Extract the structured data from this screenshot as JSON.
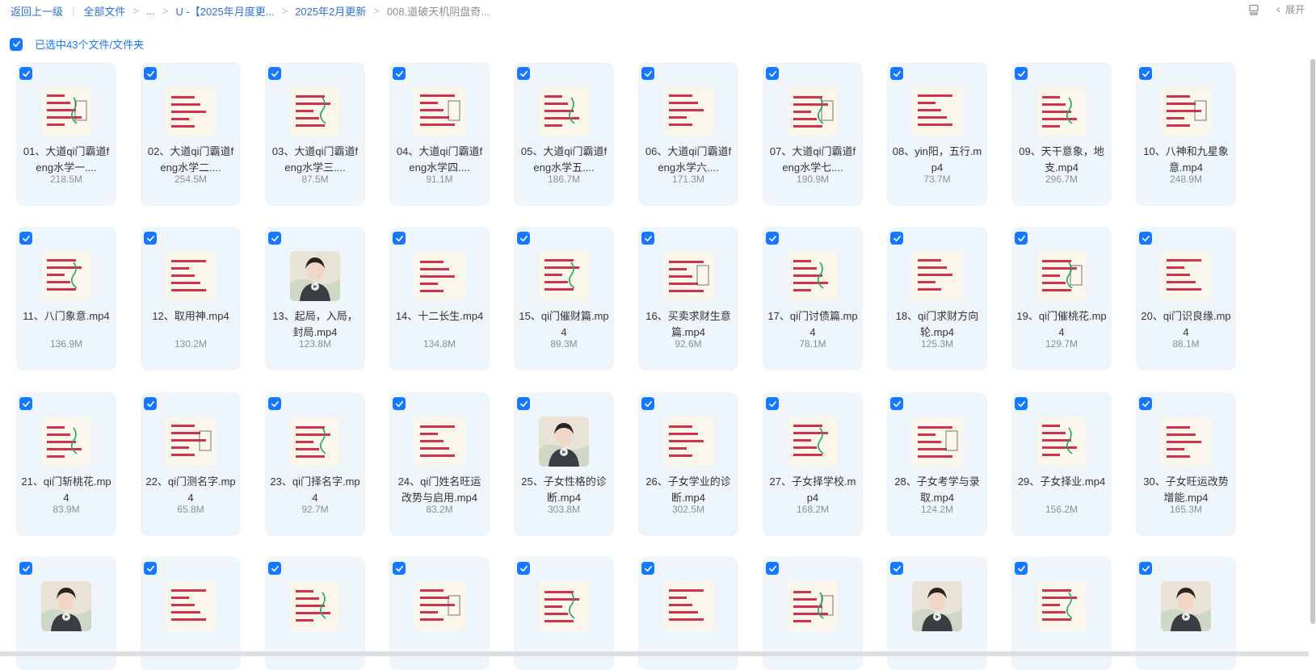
{
  "breadcrumb": {
    "back": "返回上一级",
    "root": "全部文件",
    "ellipsis": "...",
    "level1": "U -【2025年月度更...",
    "level2": "2025年2月更新",
    "current": "008.道破天机阴盘奇..."
  },
  "toolbar": {
    "expand_label": "展开"
  },
  "selection": {
    "text": "已选中43个文件/文件夹"
  },
  "colors": {
    "accent": "#1677ff",
    "tile_bg": "#eef6fc"
  },
  "files": [
    {
      "name": "01、大道qi门霸道feng水学一....",
      "size": "218.5M",
      "thumb": "slide"
    },
    {
      "name": "02、大道qi门霸道feng水学二....",
      "size": "254.5M",
      "thumb": "slide"
    },
    {
      "name": "03、大道qi门霸道feng水学三....",
      "size": "87.5M",
      "thumb": "slide"
    },
    {
      "name": "04、大道qi门霸道feng水学四....",
      "size": "91.1M",
      "thumb": "slide"
    },
    {
      "name": "05、大道qi门霸道feng水学五....",
      "size": "186.7M",
      "thumb": "slide"
    },
    {
      "name": "06、大道qi门霸道feng水学六....",
      "size": "171.3M",
      "thumb": "slide"
    },
    {
      "name": "07、大道qi门霸道feng水学七....",
      "size": "190.9M",
      "thumb": "slide"
    },
    {
      "name": "08、yin阳，五行.mp4",
      "size": "73.7M",
      "thumb": "slide"
    },
    {
      "name": "09、天干意象，地支.mp4",
      "size": "296.7M",
      "thumb": "slide"
    },
    {
      "name": "10、八神和九星象意.mp4",
      "size": "248.9M",
      "thumb": "slide"
    },
    {
      "name": "11、八门象意.mp4",
      "size": "136.9M",
      "thumb": "slide"
    },
    {
      "name": "12、取用神.mp4",
      "size": "130.2M",
      "thumb": "slide"
    },
    {
      "name": "13、起局，入局，封局.mp4",
      "size": "123.8M",
      "thumb": "person"
    },
    {
      "name": "14、十二长生.mp4",
      "size": "134.8M",
      "thumb": "slide"
    },
    {
      "name": "15、qi门催财篇.mp4",
      "size": "89.3M",
      "thumb": "slide"
    },
    {
      "name": "16、买卖求财生意篇.mp4",
      "size": "92.6M",
      "thumb": "slide"
    },
    {
      "name": "17、qi门讨债篇.mp4",
      "size": "78.1M",
      "thumb": "slide"
    },
    {
      "name": "18、qi门求财方向轮.mp4",
      "size": "125.3M",
      "thumb": "slide"
    },
    {
      "name": "19、qi门催桃花.mp4",
      "size": "129.7M",
      "thumb": "slide"
    },
    {
      "name": "20、qi门识良缘.mp4",
      "size": "88.1M",
      "thumb": "slide"
    },
    {
      "name": "21、qi门斩桃花.mp4",
      "size": "83.9M",
      "thumb": "slide"
    },
    {
      "name": "22、qi门测名字.mp4",
      "size": "65.8M",
      "thumb": "slide"
    },
    {
      "name": "23、qi门择名字.mp4",
      "size": "92.7M",
      "thumb": "slide"
    },
    {
      "name": "24、qi门姓名旺运改势与启用.mp4",
      "size": "83.2M",
      "thumb": "slide"
    },
    {
      "name": "25、子女性格的诊断.mp4",
      "size": "303.8M",
      "thumb": "person"
    },
    {
      "name": "26、子女学业的诊断.mp4",
      "size": "302.5M",
      "thumb": "slide"
    },
    {
      "name": "27、子女择学校.mp4",
      "size": "168.2M",
      "thumb": "slide"
    },
    {
      "name": "28、子女考学与录取.mp4",
      "size": "124.2M",
      "thumb": "slide"
    },
    {
      "name": "29、子女择业.mp4",
      "size": "156.2M",
      "thumb": "slide"
    },
    {
      "name": "30、子女旺运改势增能.mp4",
      "size": "165.3M",
      "thumb": "slide"
    },
    {
      "name": "",
      "size": "",
      "thumb": "person"
    },
    {
      "name": "",
      "size": "",
      "thumb": "slide"
    },
    {
      "name": "",
      "size": "",
      "thumb": "slide"
    },
    {
      "name": "",
      "size": "",
      "thumb": "slide"
    },
    {
      "name": "",
      "size": "",
      "thumb": "slide"
    },
    {
      "name": "",
      "size": "",
      "thumb": "slide"
    },
    {
      "name": "",
      "size": "",
      "thumb": "slide"
    },
    {
      "name": "",
      "size": "",
      "thumb": "person"
    },
    {
      "name": "",
      "size": "",
      "thumb": "slide"
    },
    {
      "name": "",
      "size": "",
      "thumb": "person"
    }
  ]
}
